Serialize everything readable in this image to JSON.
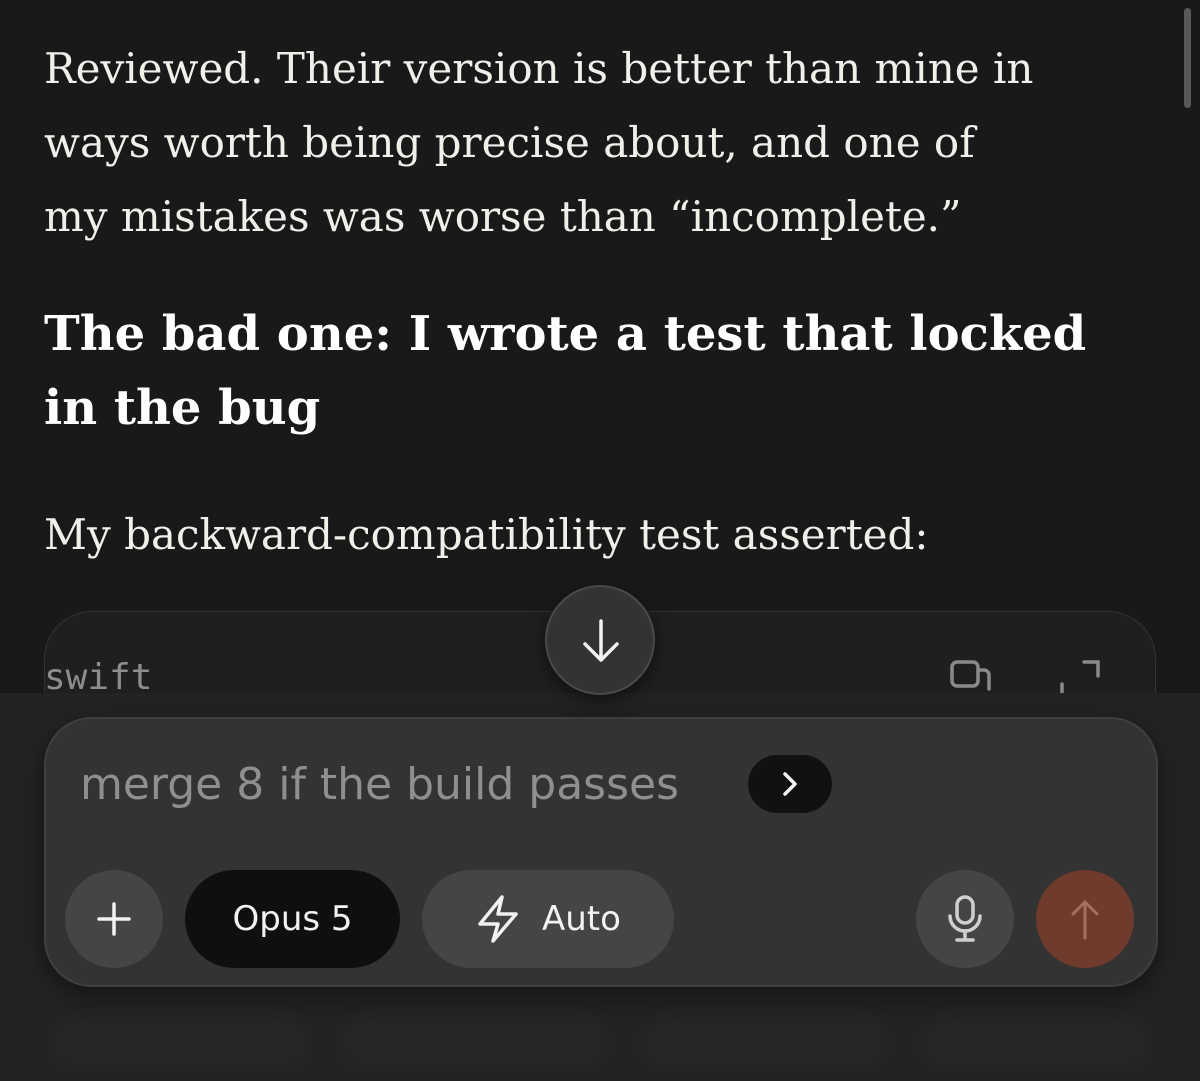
{
  "message": {
    "intro_lines": [
      "Reviewed. Their version is better than mine in",
      "ways worth being precise about, and one of",
      "my mistakes was worse than “incomplete.”"
    ],
    "heading_lines": [
      "The bad one: I wrote a test that locked",
      "in the bug"
    ],
    "lead": "My backward-compatibility test asserted:"
  },
  "code_block": {
    "language": "swift",
    "copy_icon": "copy-icon",
    "expand_icon": "expand-icon"
  },
  "scroll_down": {
    "icon": "arrow-down-icon"
  },
  "composer": {
    "prompt_text": "merge 8 if the build passes",
    "suggestion_icon": "chevron-right-icon",
    "add_icon": "plus-icon",
    "model_label": "Opus 5",
    "mode_icon": "lightning-bolt-icon",
    "mode_label": "Auto",
    "mic_icon": "microphone-icon",
    "send_icon": "arrow-up-icon"
  },
  "colors": {
    "background": "#191919",
    "text": "#f0efea",
    "composer": "#333333",
    "send_button": "#6e3b2c"
  }
}
